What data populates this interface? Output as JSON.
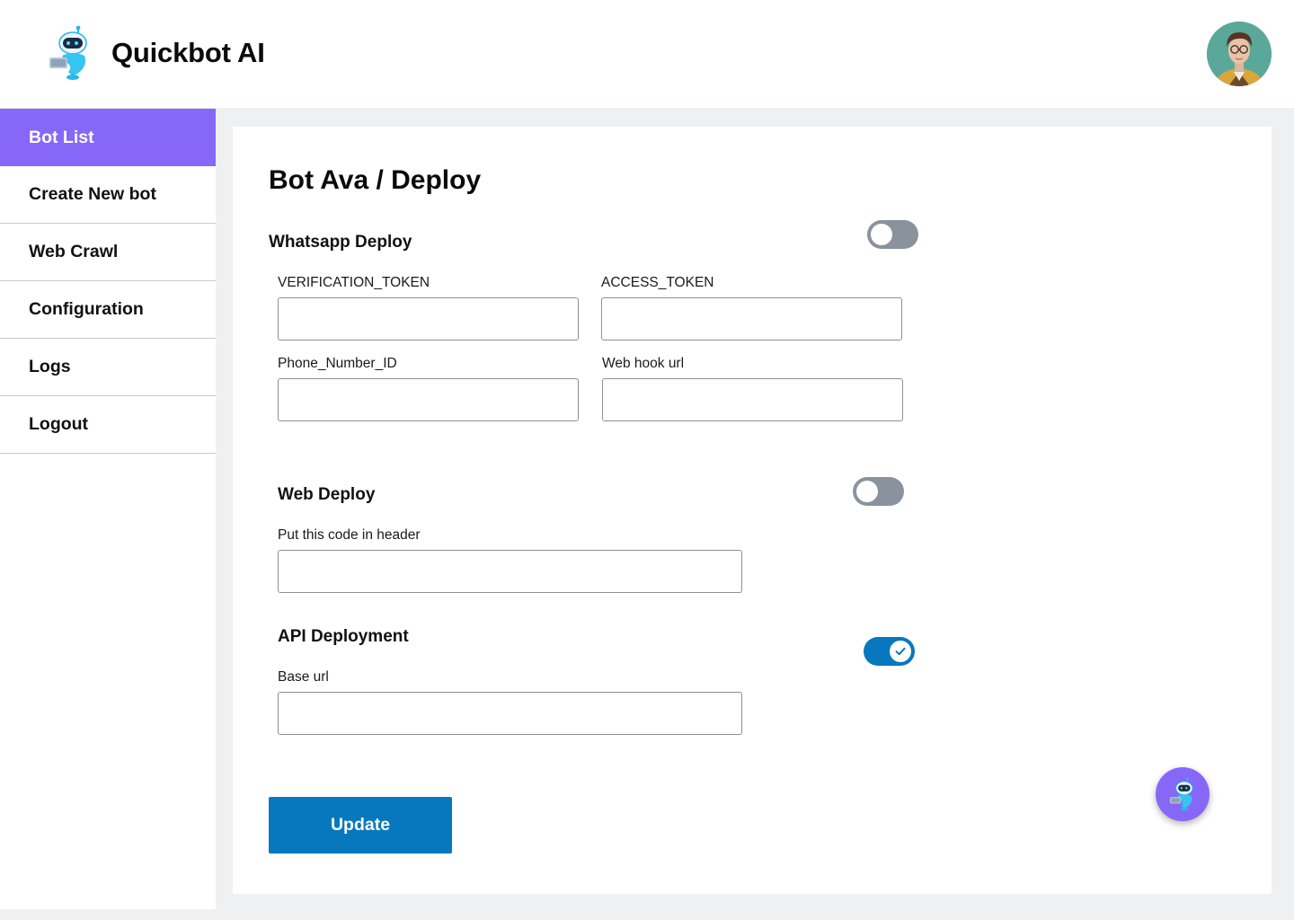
{
  "header": {
    "brand": "Quickbot AI",
    "logo_icon": "robot-icon",
    "avatar_icon": "user-avatar"
  },
  "sidebar": {
    "items": [
      {
        "label": "Bot List",
        "active": true
      },
      {
        "label": "Create New bot",
        "active": false
      },
      {
        "label": "Web Crawl",
        "active": false
      },
      {
        "label": "Configuration",
        "active": false
      },
      {
        "label": "Logs",
        "active": false
      },
      {
        "label": "Logout",
        "active": false
      }
    ]
  },
  "main": {
    "title": "Bot Ava / Deploy",
    "whatsapp": {
      "title": "Whatsapp Deploy",
      "enabled": false,
      "fields": {
        "verification_token": {
          "label": "VERIFICATION_TOKEN",
          "value": ""
        },
        "access_token": {
          "label": "ACCESS_TOKEN",
          "value": ""
        },
        "phone_number_id": {
          "label": "Phone_Number_ID",
          "value": ""
        },
        "webhook_url": {
          "label": "Web hook url",
          "value": ""
        }
      }
    },
    "web": {
      "title": "Web Deploy",
      "enabled": false,
      "header_code": {
        "label": "Put this code in header",
        "value": ""
      }
    },
    "api": {
      "title": "API Deployment",
      "enabled": true,
      "base_url": {
        "label": "Base url",
        "value": ""
      }
    },
    "update_label": "Update"
  },
  "colors": {
    "accent_purple": "#8767f8",
    "primary_blue": "#0778be",
    "toggle_off": "#8a939d",
    "page_bg": "#eff0f2"
  }
}
